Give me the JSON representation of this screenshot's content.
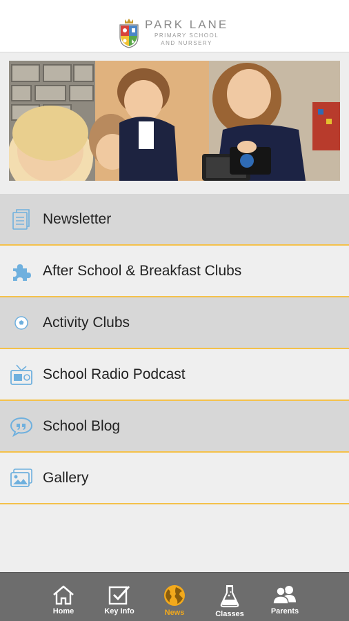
{
  "header": {
    "title": "PARK LANE",
    "subtitle_line1": "PRIMARY SCHOOL",
    "subtitle_line2": "AND NURSERY"
  },
  "menu": {
    "items": [
      {
        "label": "Newsletter",
        "icon": "document-icon"
      },
      {
        "label": "After School & Breakfast Clubs",
        "icon": "puzzle-icon"
      },
      {
        "label": "Activity Clubs",
        "icon": "football-icon"
      },
      {
        "label": "School Radio Podcast",
        "icon": "radio-icon"
      },
      {
        "label": "School Blog",
        "icon": "speech-bubble-icon"
      },
      {
        "label": "Gallery",
        "icon": "photos-icon"
      }
    ]
  },
  "tabbar": {
    "tabs": [
      {
        "label": "Home",
        "icon": "home-icon"
      },
      {
        "label": "Key Info",
        "icon": "checkbox-icon"
      },
      {
        "label": "News",
        "icon": "globe-icon"
      },
      {
        "label": "Classes",
        "icon": "flask-icon"
      },
      {
        "label": "Parents",
        "icon": "people-icon"
      }
    ],
    "active": "News"
  },
  "colors": {
    "accent": "#f2a91c",
    "separator": "#f4c14a",
    "icon_blue": "#6fb0de",
    "tabbar_bg": "#6d6d6d"
  }
}
